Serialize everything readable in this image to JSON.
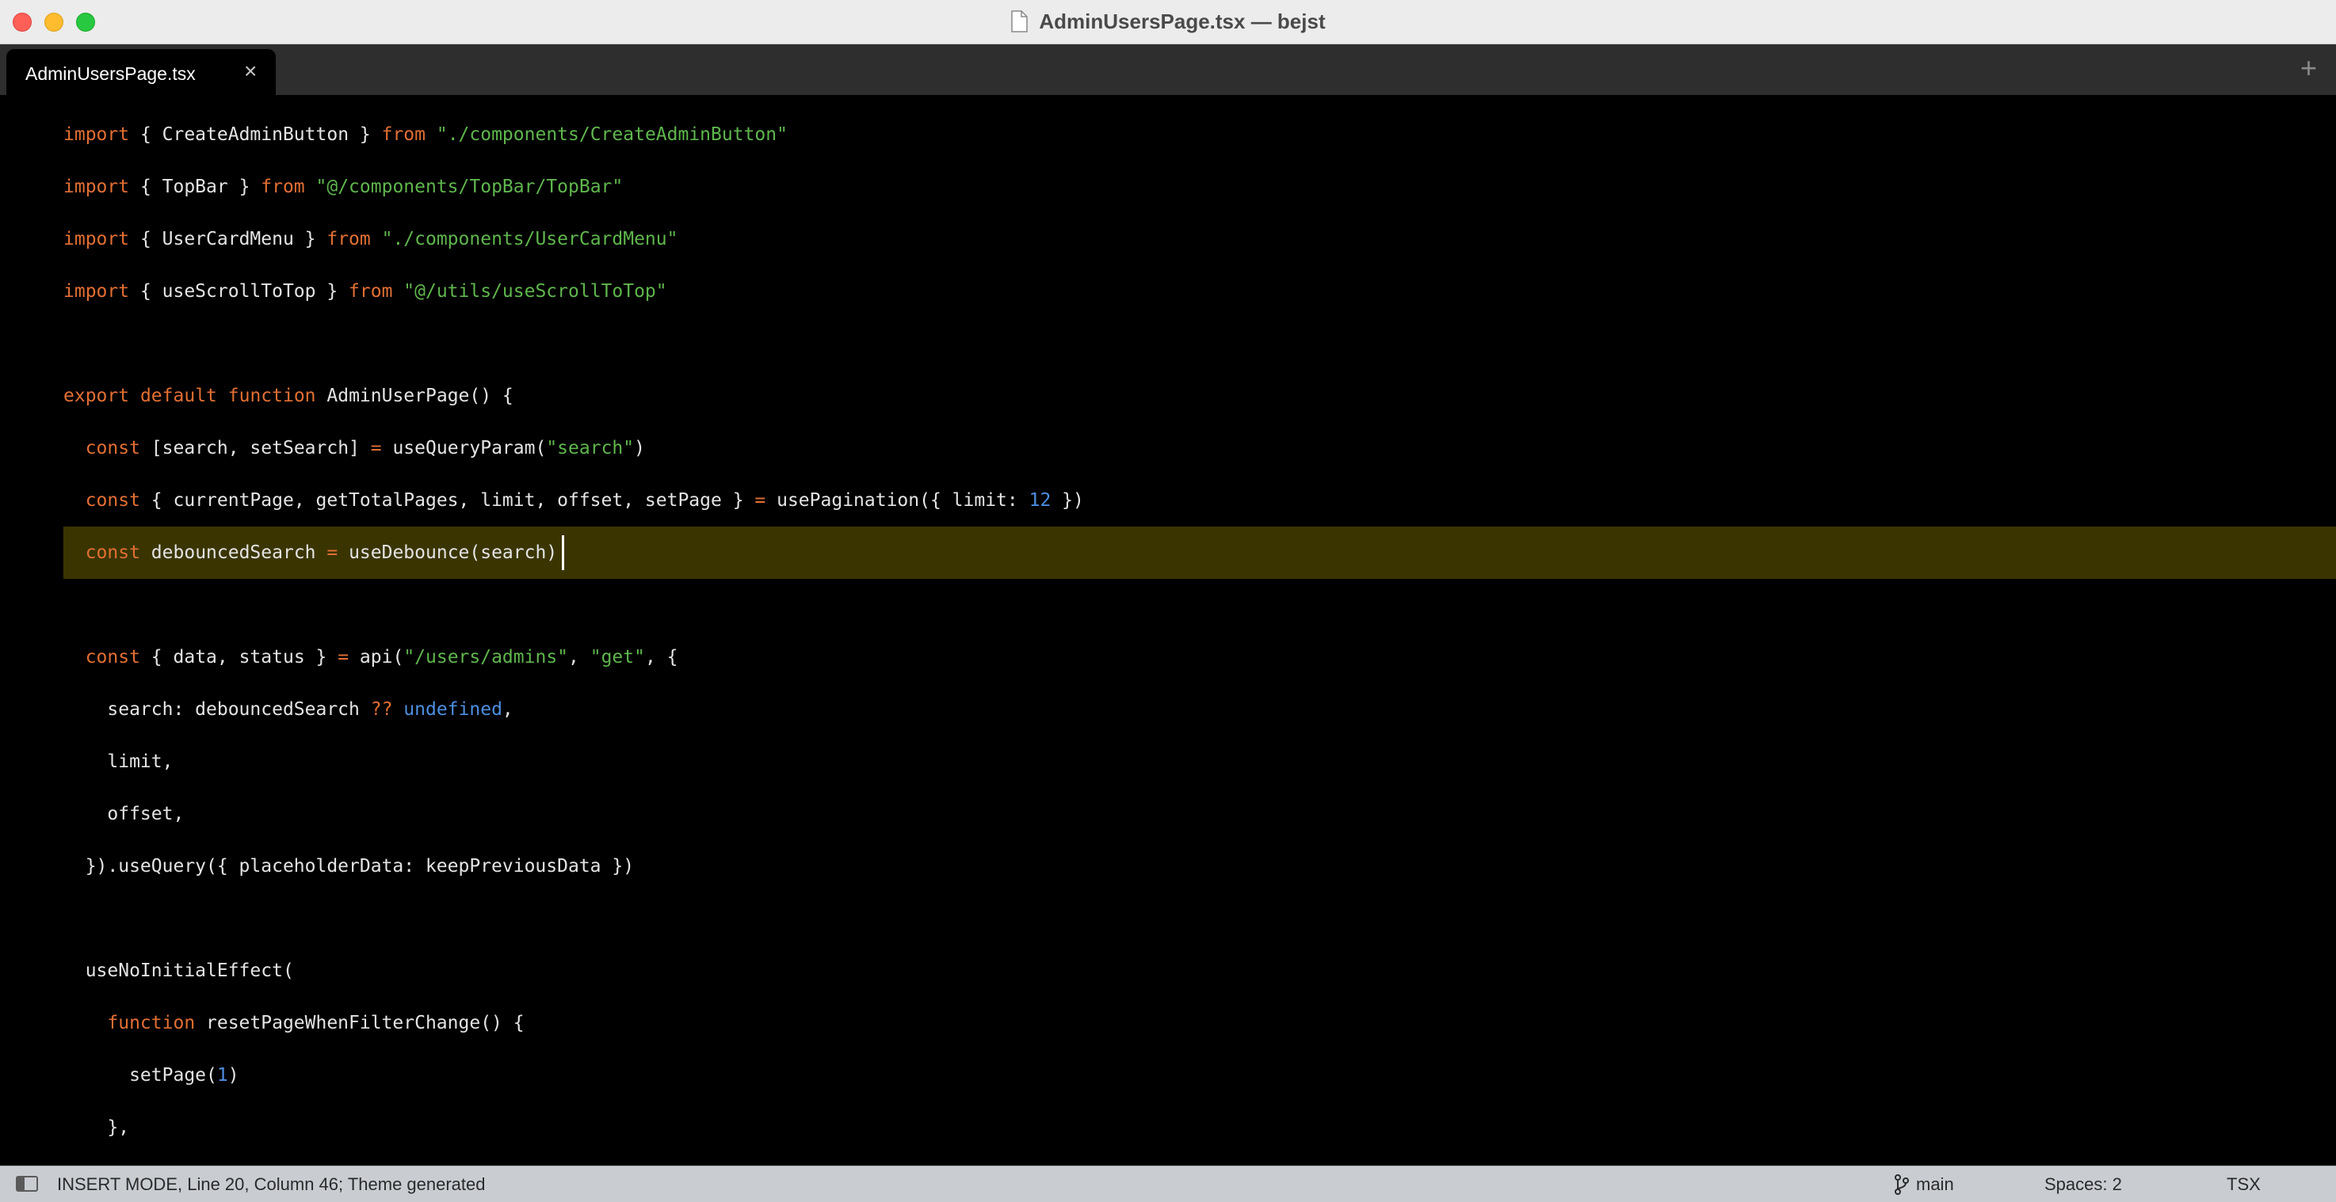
{
  "window": {
    "title": "AdminUsersPage.tsx — bejst"
  },
  "tabs": [
    {
      "label": "AdminUsersPage.tsx",
      "close_glyph": "×",
      "active": true
    }
  ],
  "tabbar": {
    "new_tab_glyph": "+"
  },
  "editor": {
    "current_line_index": 8,
    "lines": [
      [
        [
          "kw",
          "import"
        ],
        [
          "pun",
          " { CreateAdminButton } "
        ],
        [
          "kw",
          "from"
        ],
        [
          "pun",
          " "
        ],
        [
          "str",
          "\"./components/CreateAdminButton\""
        ]
      ],
      [
        [
          "kw",
          "import"
        ],
        [
          "pun",
          " { TopBar } "
        ],
        [
          "kw",
          "from"
        ],
        [
          "pun",
          " "
        ],
        [
          "str",
          "\"@/components/TopBar/TopBar\""
        ]
      ],
      [
        [
          "kw",
          "import"
        ],
        [
          "pun",
          " { UserCardMenu } "
        ],
        [
          "kw",
          "from"
        ],
        [
          "pun",
          " "
        ],
        [
          "str",
          "\"./components/UserCardMenu\""
        ]
      ],
      [
        [
          "kw",
          "import"
        ],
        [
          "pun",
          " { useScrollToTop } "
        ],
        [
          "kw",
          "from"
        ],
        [
          "pun",
          " "
        ],
        [
          "str",
          "\"@/utils/useScrollToTop\""
        ]
      ],
      [],
      [
        [
          "kw",
          "export"
        ],
        [
          "pun",
          " "
        ],
        [
          "kw",
          "default"
        ],
        [
          "pun",
          " "
        ],
        [
          "kw",
          "function"
        ],
        [
          "pun",
          " AdminUserPage() {"
        ]
      ],
      [
        [
          "pun",
          "  "
        ],
        [
          "kw",
          "const"
        ],
        [
          "pun",
          " [search, setSearch] "
        ],
        [
          "kw",
          "="
        ],
        [
          "pun",
          " useQueryParam("
        ],
        [
          "str",
          "\"search\""
        ],
        [
          "pun",
          ")"
        ]
      ],
      [
        [
          "pun",
          "  "
        ],
        [
          "kw",
          "const"
        ],
        [
          "pun",
          " { currentPage, getTotalPages, limit, offset, setPage } "
        ],
        [
          "kw",
          "="
        ],
        [
          "pun",
          " usePagination({ limit: "
        ],
        [
          "num",
          "12"
        ],
        [
          "pun",
          " })"
        ]
      ],
      [
        [
          "pun",
          "  "
        ],
        [
          "kw",
          "const"
        ],
        [
          "pun",
          " debouncedSearch "
        ],
        [
          "kw",
          "="
        ],
        [
          "pun",
          " useDebounce(search)"
        ]
      ],
      [],
      [
        [
          "pun",
          "  "
        ],
        [
          "kw",
          "const"
        ],
        [
          "pun",
          " { data, status } "
        ],
        [
          "kw",
          "="
        ],
        [
          "pun",
          " api("
        ],
        [
          "str",
          "\"/users/admins\""
        ],
        [
          "pun",
          ", "
        ],
        [
          "str",
          "\"get\""
        ],
        [
          "pun",
          ", {"
        ]
      ],
      [
        [
          "pun",
          "    search: debouncedSearch "
        ],
        [
          "kw",
          "??"
        ],
        [
          "pun",
          " "
        ],
        [
          "num",
          "undefined"
        ],
        [
          "pun",
          ","
        ]
      ],
      [
        [
          "pun",
          "    limit,"
        ]
      ],
      [
        [
          "pun",
          "    offset,"
        ]
      ],
      [
        [
          "pun",
          "  }).useQuery({ placeholderData: keepPreviousData })"
        ]
      ],
      [],
      [
        [
          "pun",
          "  useNoInitialEffect("
        ]
      ],
      [
        [
          "pun",
          "    "
        ],
        [
          "kw",
          "function"
        ],
        [
          "pun",
          " resetPageWhenFilterChange() {"
        ]
      ],
      [
        [
          "pun",
          "      setPage("
        ],
        [
          "num",
          "1"
        ],
        [
          "pun",
          ")"
        ]
      ],
      [
        [
          "pun",
          "    },"
        ]
      ]
    ]
  },
  "statusbar": {
    "mode_text": "INSERT MODE, Line 20, Column 46; Theme generated",
    "branch": "main",
    "indentation": "Spaces: 2",
    "syntax": "TSX"
  },
  "colors": {
    "keyword": "#e26f33",
    "string": "#5fb64d",
    "number": "#4d8ee0",
    "plain": "#e4e4e4",
    "current_line": "#3a3500"
  },
  "icons": {
    "window_close": "close-icon",
    "window_minimize": "minimize-icon",
    "window_maximize": "maximize-icon",
    "document": "document-icon",
    "sidebar": "sidebar-toggle-icon",
    "branch": "git-branch-icon"
  }
}
